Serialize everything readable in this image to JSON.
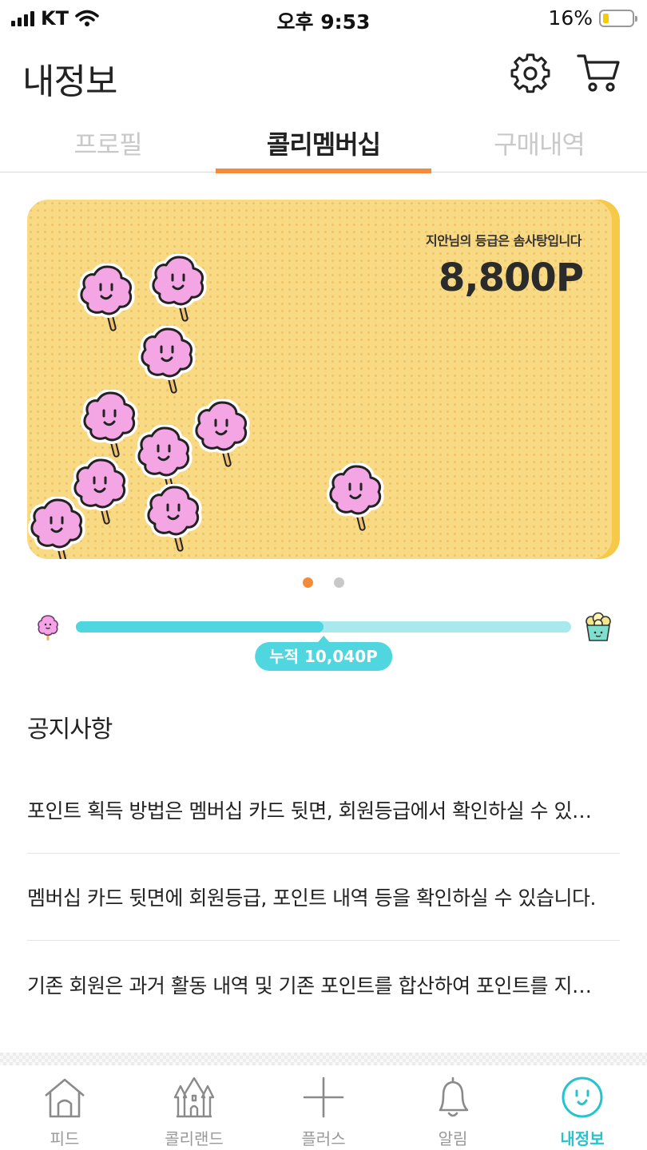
{
  "status_bar": {
    "carrier": "KT",
    "time": "오후 9:53",
    "battery": "16%"
  },
  "header": {
    "title": "내정보",
    "icons": [
      "gear-icon",
      "cart-icon"
    ]
  },
  "tabs": [
    {
      "label": "프로필",
      "active": false
    },
    {
      "label": "콜리멤버십",
      "active": true
    },
    {
      "label": "구매내역",
      "active": false
    }
  ],
  "card": {
    "grade_text": "지안님의 등급은 솜사탕입니다",
    "points": "8,800P",
    "background_color": "#f8d984",
    "accent_color": "#f7c948"
  },
  "pager": {
    "count": 2,
    "active_index": 0
  },
  "progress": {
    "accumulated_label": "누적 10,040P",
    "fill_fraction": 0.5,
    "start_icon": "cotton-candy-icon",
    "end_icon": "popcorn-icon",
    "color": "#4fd6df"
  },
  "notices": {
    "title": "공지사항",
    "items": [
      "포인트 획득 방법은 멤버십 카드 뒷면, 회원등급에서 확인하실 수 있…",
      "멤버십 카드 뒷면에 회원등급, 포인트 내역 등을 확인하실 수 있습니다.",
      "기존 회원은 과거 활동 내역 및 기존 포인트를 합산하여 포인트를 지…"
    ]
  },
  "bottom_nav": [
    {
      "label": "피드",
      "icon": "house-icon",
      "active": false
    },
    {
      "label": "콜리랜드",
      "icon": "castle-icon",
      "active": false
    },
    {
      "label": "플러스",
      "icon": "plus-icon",
      "active": false
    },
    {
      "label": "알림",
      "icon": "bell-icon",
      "active": false
    },
    {
      "label": "내정보",
      "icon": "smile-icon",
      "active": true
    }
  ],
  "colors": {
    "accent_orange": "#f58a3b",
    "accent_teal": "#24c3d0"
  }
}
